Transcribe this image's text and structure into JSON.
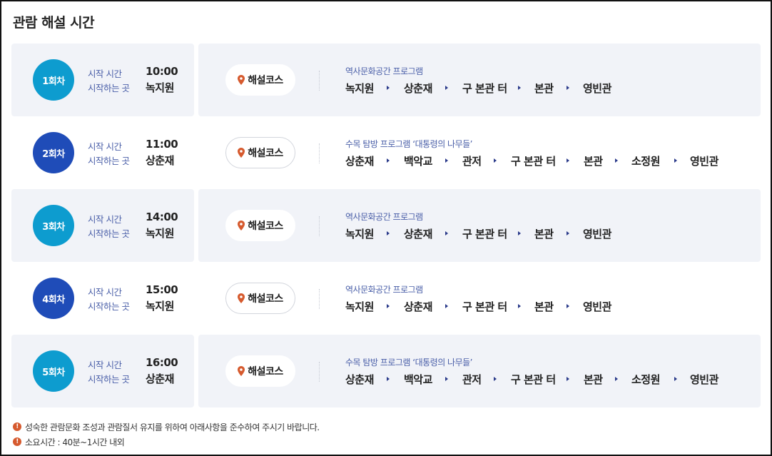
{
  "title": "관람 해설 시간",
  "labels": {
    "start_time": "시작 시간",
    "start_place": "시작하는 곳",
    "course_button": "해설코스"
  },
  "colors": {
    "teal": "#0d9ccf",
    "navy": "#1f4cb8",
    "shade": "#f1f3f8",
    "pin": "#d65a2e"
  },
  "sessions": [
    {
      "round": "1회차",
      "time": "10:00",
      "place": "녹지원",
      "course": "역사문화공간 프로그램",
      "stops": [
        "녹지원",
        "상춘재",
        "구 본관 터",
        "본관",
        "영빈관"
      ]
    },
    {
      "round": "2회차",
      "time": "11:00",
      "place": "상춘재",
      "course": "수목 탐방 프로그램 ‘대통령의 나무들’",
      "stops": [
        "상춘재",
        "백악교",
        "관저",
        "구 본관 터",
        "본관",
        "소정원",
        "영빈관"
      ]
    },
    {
      "round": "3회차",
      "time": "14:00",
      "place": "녹지원",
      "course": "역사문화공간 프로그램",
      "stops": [
        "녹지원",
        "상춘재",
        "구 본관 터",
        "본관",
        "영빈관"
      ]
    },
    {
      "round": "4회차",
      "time": "15:00",
      "place": "녹지원",
      "course": "역사문화공간 프로그램",
      "stops": [
        "녹지원",
        "상춘재",
        "구 본관 터",
        "본관",
        "영빈관"
      ]
    },
    {
      "round": "5회차",
      "time": "16:00",
      "place": "상춘재",
      "course": "수목 탐방 프로그램 ‘대통령의 나무들’",
      "stops": [
        "상춘재",
        "백악교",
        "관저",
        "구 본관 터",
        "본관",
        "소정원",
        "영빈관"
      ]
    }
  ],
  "notes": [
    "성숙한 관람문화 조성과 관람질서 유지를 위하여 아래사항을 준수하여 주시기 바랍니다.",
    "소요시간 : 40분~1시간 내외"
  ]
}
